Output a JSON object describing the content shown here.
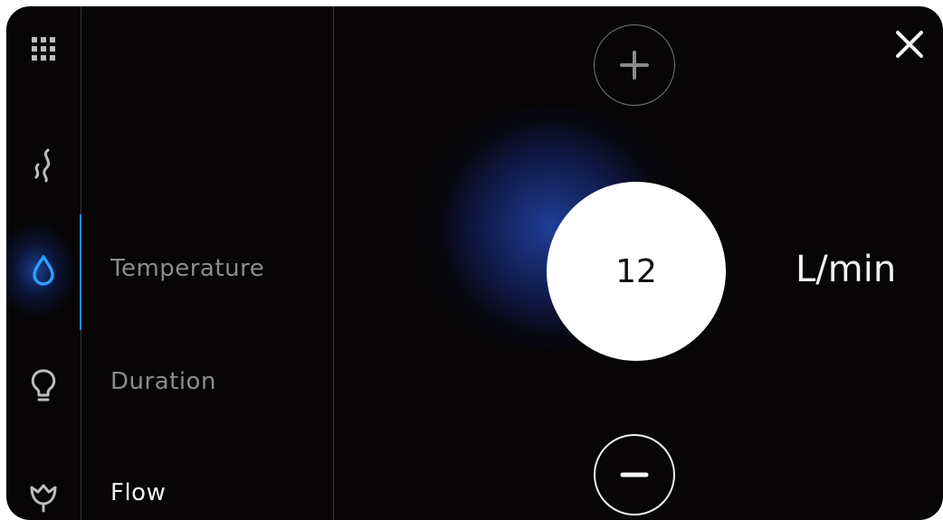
{
  "rail": {
    "items": [
      {
        "icon": "grid-icon"
      },
      {
        "icon": "steam-icon"
      },
      {
        "icon": "water-drop-icon",
        "active": true
      },
      {
        "icon": "lightbulb-icon"
      },
      {
        "icon": "lotus-icon"
      }
    ],
    "accent_color": "#1a8fe0"
  },
  "menu": {
    "items": [
      {
        "label": "Temperature"
      },
      {
        "label": "Duration"
      },
      {
        "label": "Flow",
        "selected": true
      }
    ]
  },
  "control": {
    "value": "12",
    "unit": "L/min",
    "increase_icon": "plus-icon",
    "decrease_icon": "minus-icon",
    "close_icon": "close-icon"
  }
}
